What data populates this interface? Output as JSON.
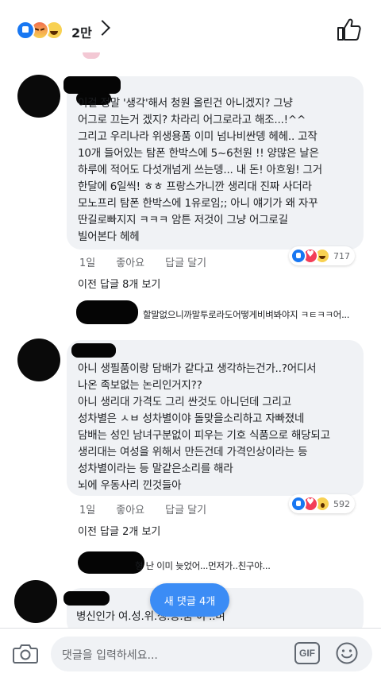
{
  "header": {
    "reaction_count": "2만",
    "reactions": [
      "like",
      "angry",
      "haha"
    ]
  },
  "comments": [
    {
      "text": "이걸 정말 '생각'해서 청원 올린건 아니겠지? 그냥\n어그로 끄는거 겠지? 차라리 어그로라고 해조...!^^\n그리고 우리나라 위생용품 이미 넘나비싼뎅 헤헤.. 고작\n10개 들어있는 탐폰 한박스에 5~6천원 !! 양많은 날은\n하루에 적어도 다섯개넘게 쓰는뎅... 내 돈! 아흐윙! 그거\n한달에 6일씩! ㅎㅎ 프랑스가니깐 생리대 진짜 사더라\n모노프리 탐폰 한박스에 1유로임;; 아니 얘기가 왜 자꾸\n딴길로빠지지 ㅋㅋㅋ 암튼 저것이 그냥 어그로길\n빌어본다 헤헤",
      "time": "1일",
      "like": "좋아요",
      "reply": "답글 달기",
      "reaction_count": "717",
      "reactions": [
        "like",
        "love",
        "haha"
      ],
      "more_replies": "이전 답글 8개 보기",
      "last_reply": "할말없으니까말투로라도어떻게비벼봐야지 ㅋㅌㅋㅋ어..."
    },
    {
      "text": "아니 생필품이랑 담배가 같다고 생각하는건가..?어디서\n나온 족보없는 논리인거지??\n아니 생리대 가격도 그리 싼것도 아니던데 그리고\n성차별은 ㅅㅂ 성차별이야 돌맞을소리하고 자빠졌네\n담배는 성인 남녀구분없이 피우는 기호 식품으로 해당되고\n생리대는 여성을 위해서 만든건데 가격인상이라는 등\n성차별이라는 등 말같은소리를 해라\n뇌에 우동사리 낀것들아",
      "time": "1일",
      "like": "좋아요",
      "reply": "답글 달기",
      "reaction_count": "592",
      "reactions": [
        "like",
        "love",
        "wow"
      ],
      "more_replies": "이전 답글 2개 보기",
      "last_reply": "형 난 이미 늦었어...먼저가..친구야..."
    },
    {
      "text": "병신인가 여.성.위.생.용.품 이 ..며"
    }
  ],
  "new_comments_button": "새 댓글 4개",
  "composer": {
    "placeholder": "댓글을 입력하세요...",
    "gif_label": "GIF"
  },
  "colors": {
    "bubble": "#f0f2f5",
    "accent": "#3b8cf5",
    "meta_text": "#65676b"
  }
}
